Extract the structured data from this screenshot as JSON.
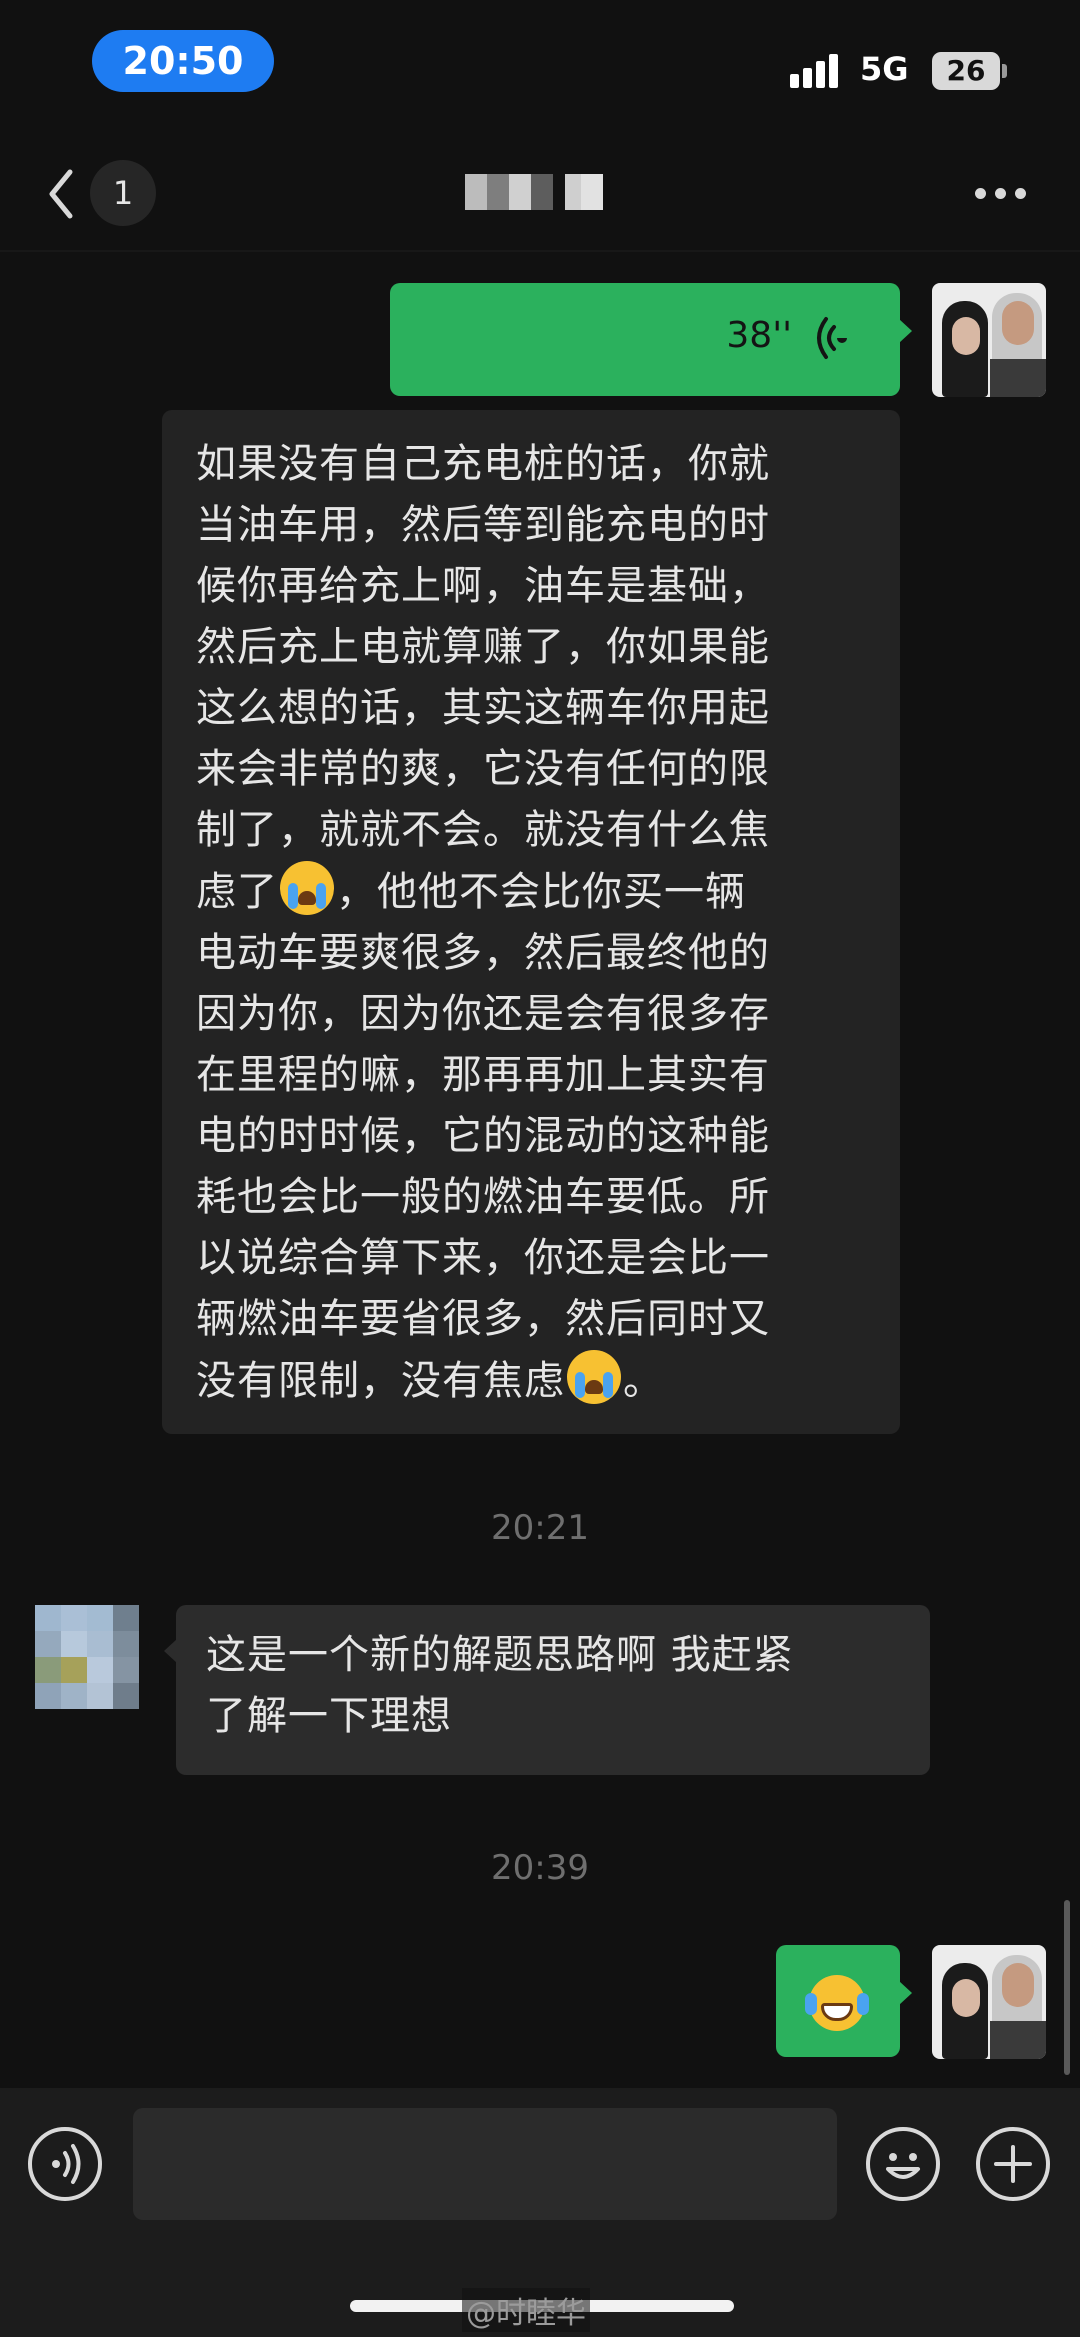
{
  "status_bar": {
    "time": "20:50",
    "network": "5G",
    "battery": "26"
  },
  "nav": {
    "unread_count": "1"
  },
  "messages": {
    "voice": {
      "duration": "38''"
    },
    "transcript_lines": [
      "如果没有自己充电桩的话，你就",
      "当油车用，然后等到能充电的时",
      "候你再给充上啊，油车是基础，",
      "然后充上电就算赚了，你如果能",
      "这么想的话，其实这辆车你用起",
      "来会非常的爽，它没有任何的限",
      "制了，就就不会。就没有什么焦",
      "虑了",
      "，他他不会比你买一辆",
      "电动车要爽很多，然后最终他的",
      "因为你，因为你还是会有很多存",
      "在里程的嘛，那再再加上其实有",
      "电的时时候，它的混动的这种能",
      "耗也会比一般的燃油车要低。所",
      "以说综合算下来，你还是会比一",
      "辆燃油车要省很多，然后同时又",
      "没有限制，没有焦虑",
      "。"
    ],
    "timestamp_1": "20:21",
    "reply_lines": [
      "这是一个新的解题思路啊 我赶紧",
      "了解一下理想"
    ],
    "timestamp_2": "20:39"
  },
  "watermark": "@时睦华",
  "colors": {
    "sent_bubble": "#2bb15d",
    "received_bubble": "#2c2c2c",
    "transcript_bubble": "#232323",
    "background": "#111111",
    "time_pill": "#1e7cf2"
  },
  "icons": [
    "chevron-left-icon",
    "more-icon",
    "voice-wave-icon",
    "crying-emoji-icon",
    "laughing-tears-emoji-icon",
    "voice-input-icon",
    "emoji-icon",
    "plus-icon"
  ]
}
